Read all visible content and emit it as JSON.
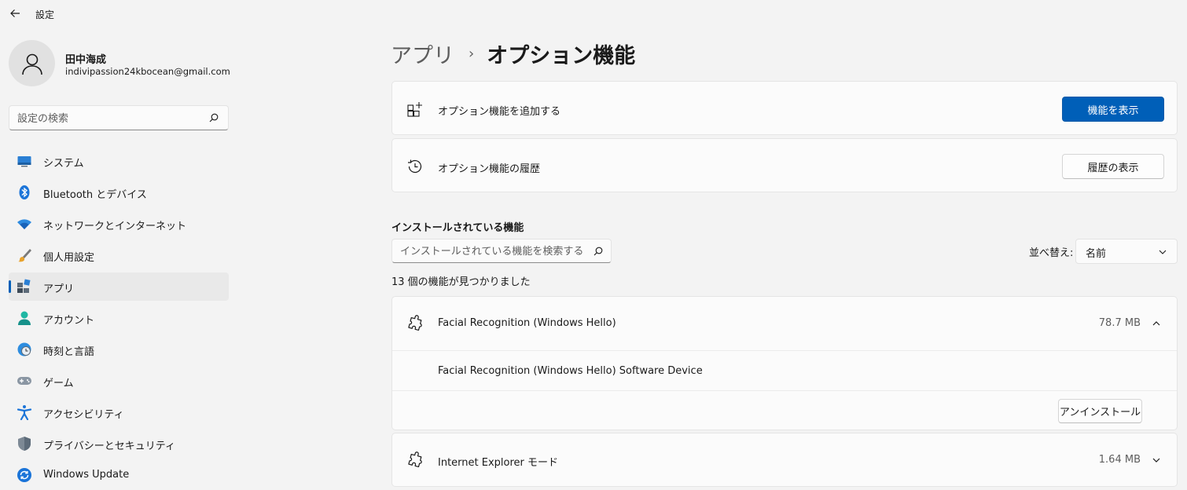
{
  "window": {
    "title": "設定"
  },
  "user": {
    "name": "田中海成",
    "email": "indivipassion24kbocean@gmail.com"
  },
  "search": {
    "placeholder": "設定の検索"
  },
  "sidebar": {
    "items": [
      {
        "label": "システム",
        "icon": "monitor-icon"
      },
      {
        "label": "Bluetooth とデバイス",
        "icon": "bluetooth-icon"
      },
      {
        "label": "ネットワークとインターネット",
        "icon": "wifi-icon"
      },
      {
        "label": "個人用設定",
        "icon": "brush-icon"
      },
      {
        "label": "アプリ",
        "icon": "apps-icon",
        "active": true
      },
      {
        "label": "アカウント",
        "icon": "person-icon"
      },
      {
        "label": "時刻と言語",
        "icon": "globe-clock-icon"
      },
      {
        "label": "ゲーム",
        "icon": "gamepad-icon"
      },
      {
        "label": "アクセシビリティ",
        "icon": "accessibility-icon"
      },
      {
        "label": "プライバシーとセキュリティ",
        "icon": "shield-icon"
      },
      {
        "label": "Windows Update",
        "icon": "update-icon"
      }
    ]
  },
  "breadcrumb": {
    "parent": "アプリ",
    "separator": "›",
    "current": "オプション機能"
  },
  "cards": {
    "add": {
      "label": "オプション機能を追加する",
      "button": "機能を表示"
    },
    "history": {
      "label": "オプション機能の履歴",
      "button": "履歴の表示"
    }
  },
  "installed": {
    "title": "インストールされている機能",
    "search_placeholder": "インストールされている機能を検索する",
    "sort_label": "並べ替え:",
    "sort_value": "名前",
    "count_text": "13 個の機能が見つかりました"
  },
  "features": [
    {
      "name": "Facial Recognition (Windows Hello)",
      "size": "78.7 MB",
      "expanded": true,
      "detail": "Facial Recognition (Windows Hello) Software Device",
      "action": "アンインストール"
    },
    {
      "name": "Internet Explorer モード",
      "size": "1.64 MB",
      "expanded": false
    }
  ],
  "colors": {
    "accent": "#005fb8",
    "background": "#f3f3f3",
    "card": "#fbfbfb"
  }
}
